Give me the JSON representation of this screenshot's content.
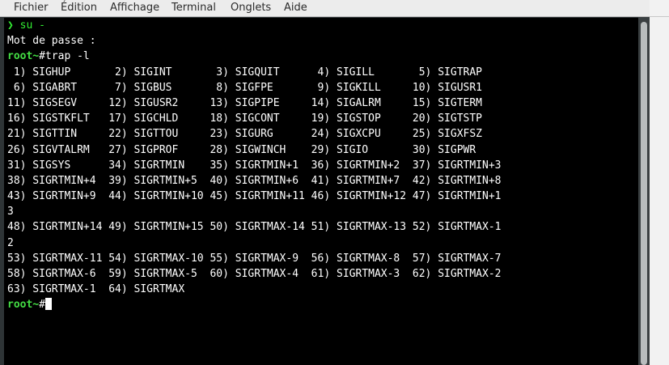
{
  "menu": {
    "items": [
      "Fichier",
      "Édition",
      "Affichage",
      "Terminal",
      "Onglets",
      "Aide"
    ]
  },
  "terminal": {
    "lines": [
      {
        "segments": [
          {
            "text": "❯ su -",
            "style": "arrow"
          }
        ]
      },
      {
        "segments": [
          {
            "text": "Mot de passe :",
            "style": "plain"
          }
        ]
      },
      {
        "segments": [
          {
            "text": "root~",
            "style": "green"
          },
          {
            "text": "#trap -l",
            "style": "plain"
          }
        ]
      },
      {
        "segments": [
          {
            "text": " 1) SIGHUP       2) SIGINT       3) SIGQUIT      4) SIGILL       5) SIGTRAP",
            "style": "plain"
          }
        ]
      },
      {
        "segments": [
          {
            "text": " 6) SIGABRT      7) SIGBUS       8) SIGFPE       9) SIGKILL     10) SIGUSR1",
            "style": "plain"
          }
        ]
      },
      {
        "segments": [
          {
            "text": "11) SIGSEGV     12) SIGUSR2     13) SIGPIPE     14) SIGALRM     15) SIGTERM",
            "style": "plain"
          }
        ]
      },
      {
        "segments": [
          {
            "text": "16) SIGSTKFLT   17) SIGCHLD     18) SIGCONT     19) SIGSTOP     20) SIGTSTP",
            "style": "plain"
          }
        ]
      },
      {
        "segments": [
          {
            "text": "21) SIGTTIN     22) SIGTTOU     23) SIGURG      24) SIGXCPU     25) SIGXFSZ",
            "style": "plain"
          }
        ]
      },
      {
        "segments": [
          {
            "text": "26) SIGVTALRM   27) SIGPROF     28) SIGWINCH    29) SIGIO       30) SIGPWR",
            "style": "plain"
          }
        ]
      },
      {
        "segments": [
          {
            "text": "31) SIGSYS      34) SIGRTMIN    35) SIGRTMIN+1  36) SIGRTMIN+2  37) SIGRTMIN+3",
            "style": "plain"
          }
        ]
      },
      {
        "segments": [
          {
            "text": "38) SIGRTMIN+4  39) SIGRTMIN+5  40) SIGRTMIN+6  41) SIGRTMIN+7  42) SIGRTMIN+8",
            "style": "plain"
          }
        ]
      },
      {
        "segments": [
          {
            "text": "43) SIGRTMIN+9  44) SIGRTMIN+10 45) SIGRTMIN+11 46) SIGRTMIN+12 47) SIGRTMIN+1",
            "style": "plain"
          }
        ]
      },
      {
        "segments": [
          {
            "text": "3",
            "style": "plain"
          }
        ]
      },
      {
        "segments": [
          {
            "text": "48) SIGRTMIN+14 49) SIGRTMIN+15 50) SIGRTMAX-14 51) SIGRTMAX-13 52) SIGRTMAX-1",
            "style": "plain"
          }
        ]
      },
      {
        "segments": [
          {
            "text": "2",
            "style": "plain"
          }
        ]
      },
      {
        "segments": [
          {
            "text": "53) SIGRTMAX-11 54) SIGRTMAX-10 55) SIGRTMAX-9  56) SIGRTMAX-8  57) SIGRTMAX-7",
            "style": "plain"
          }
        ]
      },
      {
        "segments": [
          {
            "text": "58) SIGRTMAX-6  59) SIGRTMAX-5  60) SIGRTMAX-4  61) SIGRTMAX-3  62) SIGRTMAX-2",
            "style": "plain"
          }
        ]
      },
      {
        "segments": [
          {
            "text": "63) SIGRTMAX-1  64) SIGRTMAX",
            "style": "plain"
          }
        ]
      },
      {
        "segments": [
          {
            "text": "root~",
            "style": "green"
          },
          {
            "text": "#",
            "style": "plain"
          }
        ],
        "cursor": true
      }
    ]
  },
  "colors": {
    "background": "#000000",
    "text": "#ffffff",
    "prompt": "#44dd44",
    "menubar": "#ececec"
  }
}
